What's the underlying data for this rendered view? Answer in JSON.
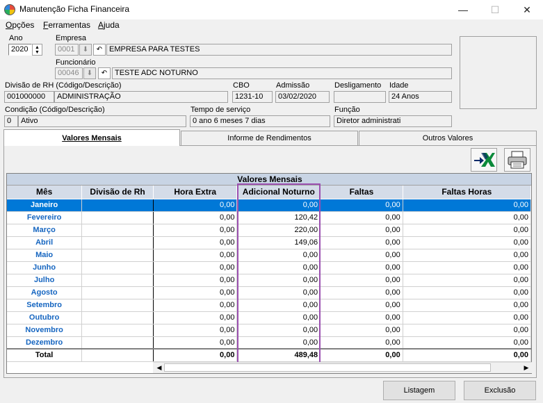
{
  "window": {
    "title": "Manutenção Ficha Financeira",
    "min": "—",
    "max": "☐",
    "close": "✕"
  },
  "menu": [
    {
      "first": "O",
      "rest": "pções"
    },
    {
      "first": "F",
      "rest": "erramentas"
    },
    {
      "first": "A",
      "rest": "juda"
    }
  ],
  "form": {
    "ano_label": "Ano",
    "ano_value": "2020",
    "empresa_label": "Empresa",
    "empresa_code": "0001",
    "empresa_name": "EMPRESA PARA TESTES",
    "funcionario_label": "Funcionário",
    "funcionario_code": "00046",
    "funcionario_name": "TESTE ADC NOTURNO",
    "divisao_label": "Divisão de RH (Código/Descrição)",
    "divisao_code": "001000000",
    "divisao_name": "ADMINISTRAÇÃO",
    "cbo_label": "CBO",
    "cbo_value": "1231-10",
    "admissao_label": "Admissão",
    "admissao_value": "03/02/2020",
    "desligamento_label": "Desligamento",
    "desligamento_value": "",
    "idade_label": "Idade",
    "idade_value": "24 Anos",
    "condicao_label": "Condição (Código/Descrição)",
    "condicao_code": "0",
    "condicao_name": "Ativo",
    "tempo_label": "Tempo de serviço",
    "tempo_value": "0 ano 6 meses 7 dias",
    "funcao_label": "Função",
    "funcao_value": "Diretor administrati"
  },
  "tabs": [
    {
      "label": "Valores Mensais",
      "active": true
    },
    {
      "label": "Informe de Rendimentos",
      "active": false
    },
    {
      "label": "Outros Valores",
      "active": false
    }
  ],
  "grid": {
    "title": "Valores Mensais",
    "columns": [
      "Mês",
      "Divisão de Rh",
      "Hora Extra",
      "Adicional Noturno",
      "Faltas",
      "Faltas Horas"
    ],
    "rows": [
      [
        "Janeiro",
        "",
        "0,00",
        "0,00",
        "0,00",
        "0,00"
      ],
      [
        "Fevereiro",
        "",
        "0,00",
        "120,42",
        "0,00",
        "0,00"
      ],
      [
        "Março",
        "",
        "0,00",
        "220,00",
        "0,00",
        "0,00"
      ],
      [
        "Abril",
        "",
        "0,00",
        "149,06",
        "0,00",
        "0,00"
      ],
      [
        "Maio",
        "",
        "0,00",
        "0,00",
        "0,00",
        "0,00"
      ],
      [
        "Junho",
        "",
        "0,00",
        "0,00",
        "0,00",
        "0,00"
      ],
      [
        "Julho",
        "",
        "0,00",
        "0,00",
        "0,00",
        "0,00"
      ],
      [
        "Agosto",
        "",
        "0,00",
        "0,00",
        "0,00",
        "0,00"
      ],
      [
        "Setembro",
        "",
        "0,00",
        "0,00",
        "0,00",
        "0,00"
      ],
      [
        "Outubro",
        "",
        "0,00",
        "0,00",
        "0,00",
        "0,00"
      ],
      [
        "Novembro",
        "",
        "0,00",
        "0,00",
        "0,00",
        "0,00"
      ],
      [
        "Dezembro",
        "",
        "0,00",
        "0,00",
        "0,00",
        "0,00"
      ]
    ],
    "total": [
      "Total",
      "",
      "0,00",
      "489,48",
      "0,00",
      "0,00"
    ],
    "selected_row": 0,
    "highlight_color": "#9b4fb0",
    "selection_color": "#0078d7"
  },
  "buttons": {
    "listagem": "Listagem",
    "exclusao": "Exclusão"
  },
  "icons": {
    "export": "excel-export-icon",
    "print": "printer-icon"
  }
}
